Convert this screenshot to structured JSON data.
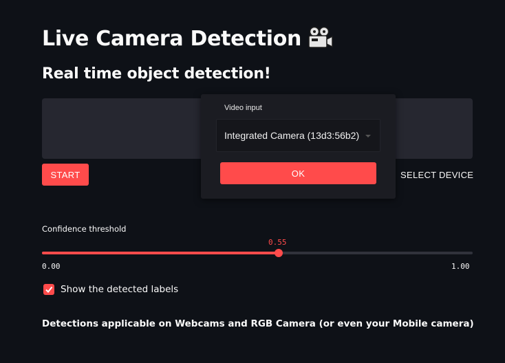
{
  "page": {
    "title": "Live Camera Detection",
    "title_icon": "film-camera-icon",
    "subtitle": "Real time object detection!"
  },
  "webrtc": {
    "start_label": "START",
    "select_device_label": "SELECT DEVICE"
  },
  "device_dialog": {
    "label": "Video input",
    "selected_device": "Integrated Camera (13d3:56b2)",
    "ok_label": "OK"
  },
  "confidence_slider": {
    "label": "Confidence threshold",
    "value": "0.55",
    "min": "0.00",
    "max": "1.00",
    "fraction": 0.55
  },
  "show_labels_checkbox": {
    "label": "Show the detected labels",
    "checked": true
  },
  "footer_note": "Detections applicable on Webcams and RGB Camera (or even your Mobile camera)",
  "colors": {
    "background": "#0e1117",
    "accent": "#ff4b4b",
    "panel": "#262730",
    "dialog": "#1b1c22"
  }
}
